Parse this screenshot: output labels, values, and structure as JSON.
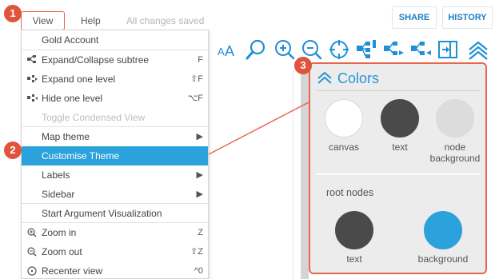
{
  "topbar": {
    "menu_view": "View",
    "menu_help": "Help",
    "save_status": "All changes saved",
    "share": "SHARE",
    "history": "HISTORY"
  },
  "callouts": [
    "1",
    "2",
    "3"
  ],
  "toolbar": {
    "text_size": "AA",
    "icons": [
      "text-size-icon",
      "search-icon",
      "zoom-in-icon",
      "zoom-out-icon",
      "recenter-icon",
      "expand-subtree-icon",
      "expand-level-icon",
      "hide-level-icon",
      "toggle-condensed-icon",
      "collapse-sidebar-icon"
    ]
  },
  "menu": {
    "gold": "Gold Account",
    "expand_collapse": "Expand/Collapse subtree",
    "expand_collapse_sc": "F",
    "expand_one": "Expand one level",
    "expand_one_sc": "⇧F",
    "hide_one": "Hide one level",
    "hide_one_sc": "⌥F",
    "toggle_condensed": "Toggle Condensed View",
    "map_theme": "Map theme",
    "customise_theme": "Customise Theme",
    "labels": "Labels",
    "sidebar": "Sidebar",
    "start_arg": "Start Argument Visualization",
    "zoom_in": "Zoom in",
    "zoom_in_sc": "Z",
    "zoom_out": "Zoom out",
    "zoom_out_sc": "⇧Z",
    "recenter": "Recenter view",
    "recenter_sc": "^0",
    "submenu_arrow": "▶"
  },
  "panel": {
    "title": "Colors",
    "swatches": [
      {
        "label": "canvas",
        "color": "#ffffff"
      },
      {
        "label": "text",
        "color": "#4a4a4a"
      },
      {
        "label_line1": "node",
        "label_line2": "background",
        "color": "#dcdcdc"
      }
    ],
    "root_title": "root nodes",
    "root_swatches": [
      {
        "label": "text",
        "color": "#4a4a4a"
      },
      {
        "label": "background",
        "color": "#2ba2dc"
      }
    ]
  },
  "colors": {
    "accent": "#2ba2dc",
    "callout": "#e0533d",
    "highlight_border": "#e8664f"
  }
}
